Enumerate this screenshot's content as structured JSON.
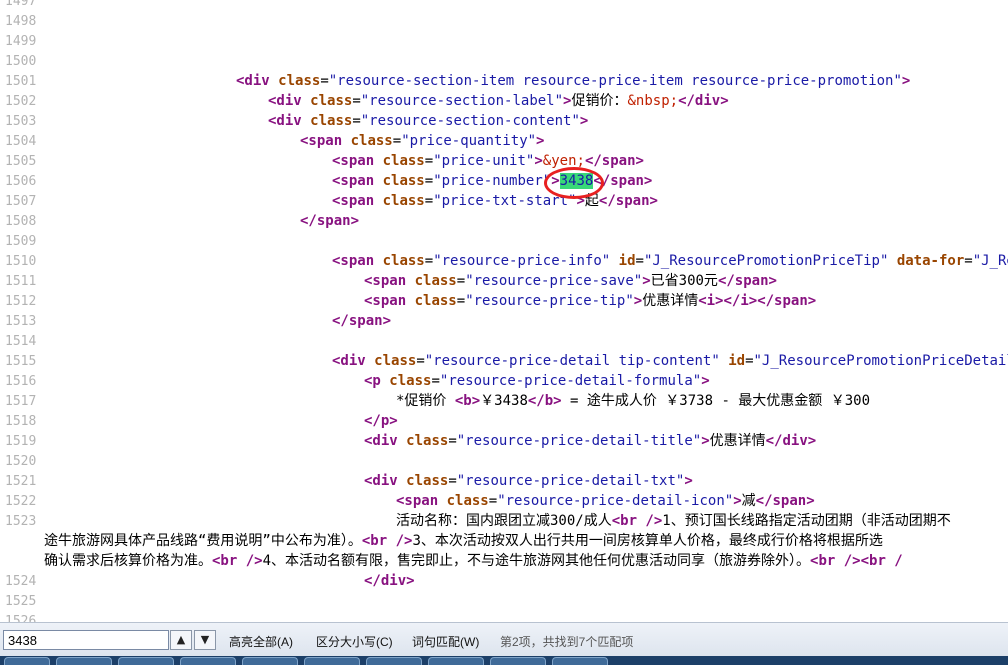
{
  "source_view": {
    "lines": [
      {
        "n": "1497",
        "indent": 0,
        "html": ""
      },
      {
        "n": "1498",
        "indent": 0,
        "html": ""
      },
      {
        "n": "1499",
        "indent": 0,
        "html": ""
      },
      {
        "n": "1500",
        "indent": 0,
        "html": ""
      },
      {
        "n": "1501",
        "indent": 5,
        "html": "<span class=\"tg\">&lt;div</span> <span class=\"an\">class</span>=<span class=\"av\">\"resource-section-item resource-price-item resource-price-promotion\"</span><span class=\"tg\">&gt;</span>"
      },
      {
        "n": "1502",
        "indent": 6,
        "html": "<span class=\"tg\">&lt;div</span> <span class=\"an\">class</span>=<span class=\"av\">\"resource-section-label\"</span><span class=\"tg\">&gt;</span>促销价：<span class=\"en\">&amp;nbsp;</span><span class=\"tg\">&lt;/div&gt;</span>"
      },
      {
        "n": "1503",
        "indent": 6,
        "html": "<span class=\"tg\">&lt;div</span> <span class=\"an\">class</span>=<span class=\"av\">\"resource-section-content\"</span><span class=\"tg\">&gt;</span>"
      },
      {
        "n": "1504",
        "indent": 7,
        "html": "<span class=\"tg\">&lt;span</span> <span class=\"an\">class</span>=<span class=\"av\">\"price-quantity\"</span><span class=\"tg\">&gt;</span>"
      },
      {
        "n": "1505",
        "indent": 8,
        "html": "<span class=\"tg\">&lt;span</span> <span class=\"an\">class</span>=<span class=\"av\">\"price-unit\"</span><span class=\"tg\">&gt;</span><span class=\"en\">&amp;yen;</span><span class=\"tg\">&lt;/span&gt;</span>"
      },
      {
        "n": "1506",
        "indent": 8,
        "html": "<span class=\"tg\">&lt;span</span> <span class=\"an\">class</span>=<span class=\"av\">\"price-number\"</span><span class=\"tg\">&gt;</span><span class=\"hl\">3438</span><span class=\"tg\">&lt;/span&gt;</span>"
      },
      {
        "n": "1507",
        "indent": 8,
        "html": "<span class=\"tg\">&lt;span</span> <span class=\"an\">class</span>=<span class=\"av\">\"price-txt-start\"</span><span class=\"tg\">&gt;</span>起<span class=\"tg\">&lt;/span&gt;</span>"
      },
      {
        "n": "1508",
        "indent": 7,
        "html": "<span class=\"tg\">&lt;/span&gt;</span>"
      },
      {
        "n": "1509",
        "indent": 0,
        "html": ""
      },
      {
        "n": "1510",
        "indent": 8,
        "html": "<span class=\"tg\">&lt;span</span> <span class=\"an\">class</span>=<span class=\"av\">\"resource-price-info\"</span> <span class=\"an\">id</span>=<span class=\"av\">\"J_ResourcePromotionPriceTip\"</span> <span class=\"an\">data-for</span>=<span class=\"av\">\"J_ResourcePromotionPriceDetail\"</span><span class=\"tg\">&gt;</span>"
      },
      {
        "n": "1511",
        "indent": 9,
        "html": "<span class=\"tg\">&lt;span</span> <span class=\"an\">class</span>=<span class=\"av\">\"resource-price-save\"</span><span class=\"tg\">&gt;</span>已省300元<span class=\"tg\">&lt;/span&gt;</span>"
      },
      {
        "n": "1512",
        "indent": 9,
        "html": "<span class=\"tg\">&lt;span</span> <span class=\"an\">class</span>=<span class=\"av\">\"resource-price-tip\"</span><span class=\"tg\">&gt;</span>优惠详情<span class=\"tg\">&lt;i&gt;&lt;/i&gt;&lt;/span&gt;</span>"
      },
      {
        "n": "1513",
        "indent": 8,
        "html": "<span class=\"tg\">&lt;/span&gt;</span>"
      },
      {
        "n": "1514",
        "indent": 0,
        "html": ""
      },
      {
        "n": "1515",
        "indent": 8,
        "html": "<span class=\"tg\">&lt;div</span> <span class=\"an\">class</span>=<span class=\"av\">\"resource-price-detail tip-content\"</span> <span class=\"an\">id</span>=<span class=\"av\">\"J_ResourcePromotionPriceDetail\"</span><span class=\"tg\">&gt;</span>"
      },
      {
        "n": "1516",
        "indent": 9,
        "html": "<span class=\"tg\">&lt;p</span> <span class=\"an\">class</span>=<span class=\"av\">\"resource-price-detail-formula\"</span><span class=\"tg\">&gt;</span>"
      },
      {
        "n": "1517",
        "indent": 10,
        "html": "*促销价 <span class=\"tg\">&lt;b&gt;</span>￥3438<span class=\"tg\">&lt;/b&gt;</span> = 途牛成人价 ￥3738 - 最大优惠金额 ￥300"
      },
      {
        "n": "1518",
        "indent": 9,
        "html": "<span class=\"tg\">&lt;/p&gt;</span>"
      },
      {
        "n": "1519",
        "indent": 9,
        "html": "<span class=\"tg\">&lt;div</span> <span class=\"an\">class</span>=<span class=\"av\">\"resource-price-detail-title\"</span><span class=\"tg\">&gt;</span>优惠详情<span class=\"tg\">&lt;/div&gt;</span>"
      },
      {
        "n": "1520",
        "indent": 0,
        "html": ""
      },
      {
        "n": "1521",
        "indent": 9,
        "html": "<span class=\"tg\">&lt;div</span> <span class=\"an\">class</span>=<span class=\"av\">\"resource-price-detail-txt\"</span><span class=\"tg\">&gt;</span>"
      },
      {
        "n": "1522",
        "indent": 10,
        "html": "<span class=\"tg\">&lt;span</span> <span class=\"an\">class</span>=<span class=\"av\">\"resource-price-detail-icon\"</span><span class=\"tg\">&gt;</span>减<span class=\"tg\">&lt;/span&gt;</span>"
      },
      {
        "n": "1523",
        "indent": 10,
        "html": "活动名称：国内跟团立减300/成人<span class=\"tg\">&lt;br /&gt;</span>1、预订国长线路指定活动团期（非活动团期不"
      }
    ],
    "wrapped": [
      {
        "html": "途牛旅游网具体产品线路“费用说明”中公布为准）。<span class=\"tg\">&lt;br /&gt;</span>3、本次活动按双人出行共用一间房核算单人价格，最终成行价格将根据所选"
      },
      {
        "html": "确认需求后核算价格为准。<span class=\"tg\">&lt;br /&gt;</span>4、本活动名额有限，售完即止，不与途牛旅游网其他任何优惠活动同享（旅游券除外）。<span class=\"tg\">&lt;br /&gt;&lt;br /</span>"
      }
    ],
    "tail": [
      {
        "n": "1524",
        "indent": 9,
        "html": "<span class=\"tg\">&lt;/div&gt;</span>"
      },
      {
        "n": "1525",
        "indent": 0,
        "html": ""
      },
      {
        "n": "1526",
        "indent": 0,
        "html": ""
      }
    ]
  },
  "find_bar": {
    "query": "3438",
    "prev_label": "▲",
    "next_label": "▼",
    "highlight_all": "高亮全部(A)",
    "match_case": "区分大小写(C)",
    "whole_word": "词句匹配(W)",
    "status": "第2项，共找到7个匹配项"
  }
}
